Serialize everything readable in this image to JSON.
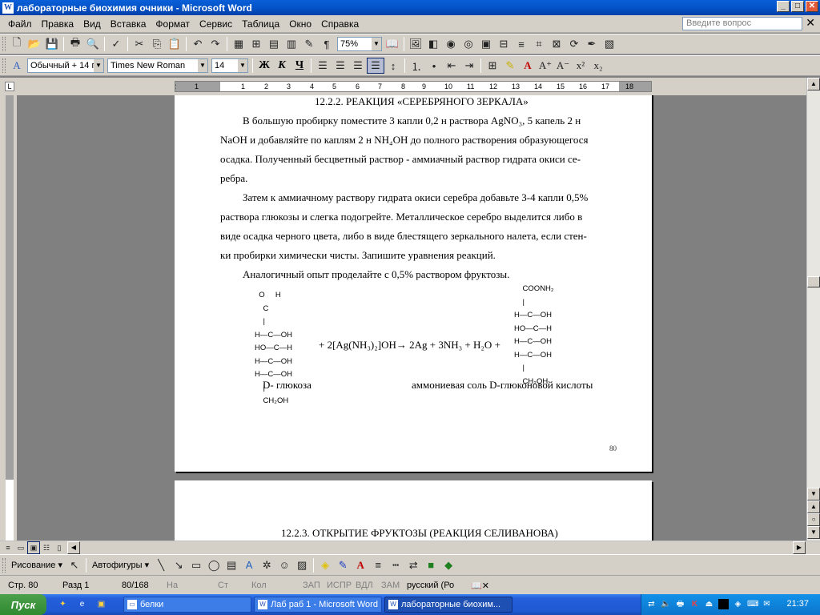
{
  "window": {
    "title": "лабораторные биохимия очники - Microsoft Word",
    "min": "_",
    "max": "□",
    "close": "✕"
  },
  "menu": {
    "items": [
      "Файл",
      "Правка",
      "Вид",
      "Вставка",
      "Формат",
      "Сервис",
      "Таблица",
      "Окно",
      "Справка"
    ],
    "help_placeholder": "Введите вопрос",
    "doc_close": "✕"
  },
  "standard_toolbar": {
    "zoom": "75%"
  },
  "formatting_toolbar": {
    "style": "Обычный + 14 п",
    "font": "Times New Roman",
    "size": "14",
    "bold": "Ж",
    "italic": "К",
    "underline": "Ч"
  },
  "ruler": {
    "numbers": [
      "2",
      "1",
      "1",
      "2",
      "3",
      "4",
      "5",
      "6",
      "7",
      "8",
      "9",
      "10",
      "11",
      "12",
      "13",
      "14",
      "15",
      "16",
      "17",
      "18"
    ]
  },
  "page1": {
    "heading": "12.2.2. РЕАКЦИЯ «СЕРЕБРЯНОГО ЗЕРКАЛА»",
    "lines": [
      "В большую пробирку поместите 3 капли 0,2 н раствора AgNO₃, 5 капель 2 н",
      "NaOH и добавляйте по каплям 2 н NH₄OH до полного растворения образующегося",
      "осадка. Полученный бесцветный раствор - аммиачный раствор гидрата окиси се-",
      "ребра.",
      "Затем к аммиачному раствору гидрата окиси серебра добавьте 3-4 капли 0,5%",
      "раствора глюкозы и слегка подогрейте. Металлическое серебро выделится либо в",
      "виде осадка черного цвета, либо в виде блестящего зеркального налета, если стен-",
      "ки пробирки химически чисты. Запишите уравнения реакций.",
      "Аналогичный опыт проделайте с 0,5% раствором фруктозы."
    ],
    "glucose_formula": "  O     H\n    C\n    |\nH—C—OH\nHO—C—H\nH—C—OH\nH—C—OH\n    |\n    CH₂OH",
    "gluconate_formula": "    COONH₂\n    |\nH—C—OH\nHO—C—H\nH—C—OH\nH—C—OH\n    |\n    CH₂OH",
    "equation": "+ 2[Ag(NH₃)₂]OH→ 2Ag + 3NH₃ + H₂O +",
    "label_left": "D- глюкоза",
    "label_right": "аммониевая соль D-глюконовой кислоты",
    "page_number": "80"
  },
  "page2": {
    "heading": "12.2.3. ОТКРЫТИЕ ФРУКТОЗЫ (РЕАКЦИЯ СЕЛИВАНОВА)"
  },
  "drawing_toolbar": {
    "draw": "Рисование ▾",
    "autoshapes": "Автофигуры ▾"
  },
  "status": {
    "page": "Стр. 80",
    "section": "Разд 1",
    "pages": "80/168",
    "at": "На",
    "line": "Ст",
    "col": "Кол",
    "rec": "ЗАП",
    "trk": "ИСПР",
    "ext": "ВДЛ",
    "ovr": "ЗАМ",
    "lang": "русский (Ро"
  },
  "taskbar": {
    "start": "Пуск",
    "tasks": [
      "белки",
      "Лаб раб 1 - Microsoft Word",
      "лабораторные биохим..."
    ],
    "clock": "21:37"
  },
  "colors": {
    "title_bar": "#0453c8",
    "taskbar": "#245edb",
    "start": "#2f8a2f",
    "tray": "#0f86dd"
  }
}
